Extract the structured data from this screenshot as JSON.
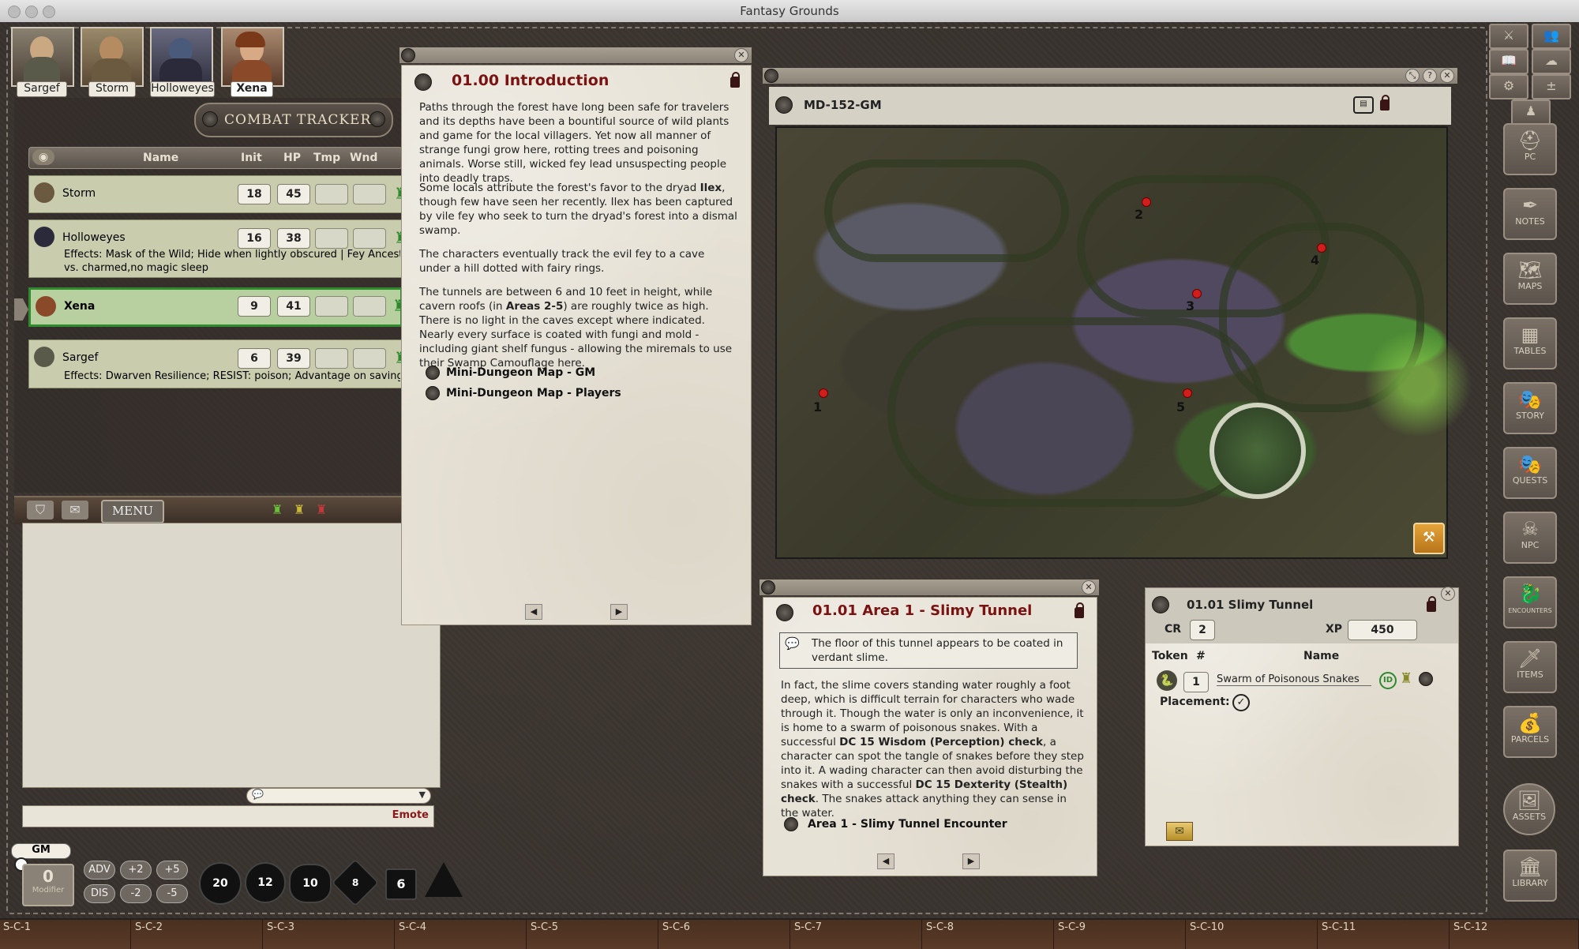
{
  "window": {
    "title": "Fantasy Grounds"
  },
  "party": [
    {
      "name": "Sargef",
      "active": false
    },
    {
      "name": "Storm",
      "active": false
    },
    {
      "name": "Holloweyes",
      "active": false
    },
    {
      "name": "Xena",
      "active": true
    }
  ],
  "combat_tracker": {
    "title": "COMBAT TRACKER",
    "columns": [
      "Name",
      "Init",
      "HP",
      "Tmp",
      "Wnd"
    ],
    "rows": [
      {
        "name": "Storm",
        "init": "18",
        "hp": "45",
        "effects": ""
      },
      {
        "name": "Holloweyes",
        "init": "16",
        "hp": "38",
        "effects": "Effects: Mask of the Wild; Hide when lightly obscured | Fey Ancest",
        "effects2": "vs. charmed,no magic sleep"
      },
      {
        "name": "Xena",
        "init": "9",
        "hp": "41",
        "effects": ""
      },
      {
        "name": "Sargef",
        "init": "6",
        "hp": "39",
        "effects": "Effects: Dwarven Resilience; RESIST: poison; Advantage on saving t"
      }
    ]
  },
  "chat": {
    "menu_label": "MENU",
    "emote_label": "Emote",
    "gm_label": "GM",
    "modifier_value": "0",
    "modifier_label": "Modifier"
  },
  "modifiers": {
    "adv": "ADV",
    "dis": "DIS",
    "p2": "+2",
    "m2": "-2",
    "p5": "+5",
    "m5": "-5"
  },
  "dice": [
    "20",
    "12",
    "10",
    "8",
    "6"
  ],
  "intro": {
    "heading": "01.00 Introduction",
    "p1": "Paths through the forest have long been safe for travelers and its depths have been a bountiful source of wild plants and game for the local villagers. Yet now all manner of strange fungi grow here, rotting trees and poisoning animals. Worse still, wicked fey lead unsuspecting people into deadly traps.",
    "p2a": "Some locals attribute the forest's favor to the dryad ",
    "p2b": "Ilex",
    "p2c": ", though few have seen her recently. Ilex has been captured by vile fey who seek to turn the dryad's forest into a dismal swamp.",
    "p3": "The characters eventually track the evil fey to a cave under a hill dotted with fairy rings.",
    "p4a": "The tunnels are between 6 and 10 feet in height, while cavern roofs (in ",
    "p4b": "Areas 2-5",
    "p4c": ") are roughly twice as high. There is no light in the caves except where indicated. Nearly every surface is coated with fungi and mold - including giant shelf fungus - allowing the miremals to use their Swamp Camouflage here.",
    "link1": "Mini-Dungeon Map - GM",
    "link2": "Mini-Dungeon Map - Players"
  },
  "map": {
    "title": "MD-152-GM",
    "pins": [
      "1",
      "2",
      "3",
      "4",
      "5"
    ]
  },
  "area": {
    "heading": "01.01 Area 1 - Slimy Tunnel",
    "boxed": "The floor of this tunnel appears to be coated in verdant slime.",
    "t1": "In fact, the slime covers standing water roughly a foot deep, which is difficult terrain for characters who wade through it. Though the water is only an inconvenience, it is home to a swarm of poisonous snakes. With a successful ",
    "t2": "DC 15 Wisdom (Perception) check",
    "t3": ", a character can spot the tangle of snakes before they step into it. A wading character can then avoid disturbing the snakes with a successful ",
    "t4": "DC 15 Dexterity (Stealth) check",
    "t5": ". The snakes attack anything they can sense in the water.",
    "link": "Area 1 - Slimy Tunnel Encounter"
  },
  "encounter": {
    "title": "01.01 Slimy Tunnel",
    "cr_label": "CR",
    "cr": "2",
    "xp_label": "XP",
    "xp": "450",
    "token_label": "Token",
    "count_label": "#",
    "name_label": "Name",
    "row": {
      "count": "1",
      "name": "Swarm of Poisonous Snakes"
    },
    "placement_label": "Placement:"
  },
  "sidebar": [
    "PC",
    "NOTES",
    "MAPS",
    "TABLES",
    "STORY",
    "QUESTS",
    "NPC",
    "ENCOUNTERS",
    "ITEMS",
    "PARCELS",
    "ASSETS",
    "LIBRARY"
  ],
  "hotkeys": [
    "S-C-1",
    "S-C-2",
    "S-C-3",
    "S-C-4",
    "S-C-5",
    "S-C-6",
    "S-C-7",
    "S-C-8",
    "S-C-9",
    "S-C-10",
    "S-C-11",
    "S-C-12"
  ]
}
